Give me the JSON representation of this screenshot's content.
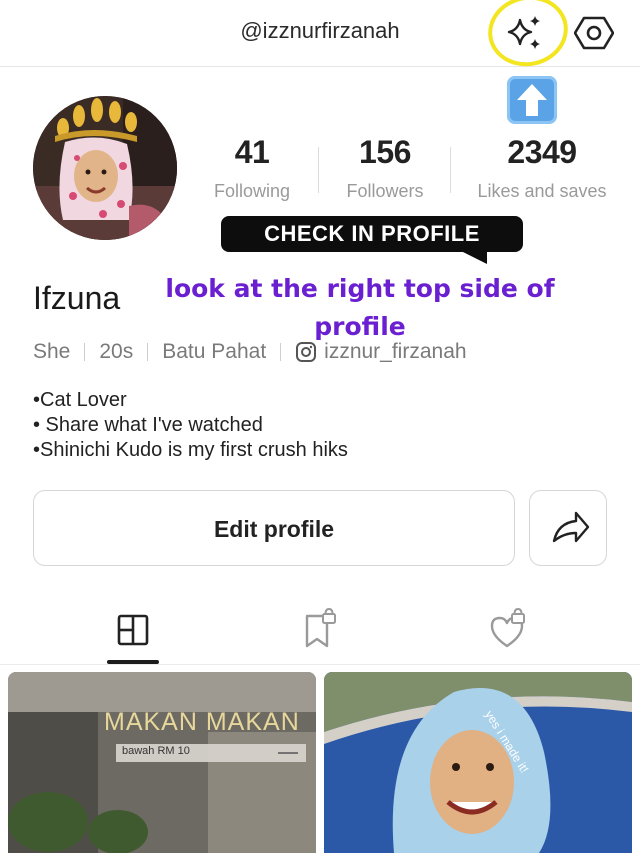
{
  "header": {
    "username": "@izznurfirzanah"
  },
  "stats": [
    {
      "value": "41",
      "label": "Following"
    },
    {
      "value": "156",
      "label": "Followers"
    },
    {
      "value": "2349",
      "label": "Likes and saves"
    }
  ],
  "overlay": {
    "bubble_text": "CHECK IN PROFILE",
    "annotation": "look at the right top side of profile"
  },
  "profile": {
    "display_name": "Ifzuna",
    "pronoun": "She",
    "age": "20s",
    "location": "Batu Pahat",
    "instagram": "izznur_firzanah",
    "bio": [
      "•Cat Lover",
      "• Share what I've watched",
      "•Shinichi Kudo is my first crush hiks"
    ]
  },
  "actions": {
    "edit_label": "Edit profile"
  },
  "posts": [
    {
      "title": "MAKAN MAKAN",
      "subtitle": "bawah RM 10"
    },
    {
      "caption": "yes i made it!"
    }
  ],
  "colors": {
    "highlight_circle": "#f3e51f",
    "annotation": "#6a1fd1",
    "bubble": "#0d0d0d"
  }
}
